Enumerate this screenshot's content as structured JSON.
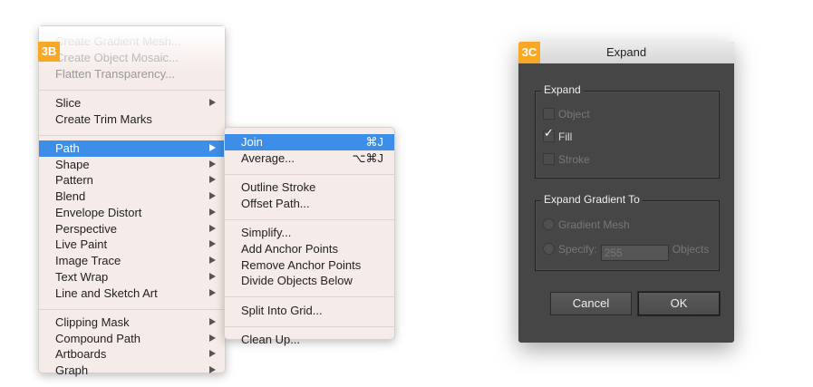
{
  "menu_badge": "3B",
  "main_menu": [
    {
      "label": "Create Gradient Mesh...",
      "state": "disabled"
    },
    {
      "label": "Create Object Mosaic...",
      "state": "disabled"
    },
    {
      "label": "Flatten Transparency...",
      "state": "disabled"
    },
    {
      "sep": true
    },
    {
      "label": "Slice",
      "submenu": true
    },
    {
      "label": "Create Trim Marks"
    },
    {
      "sep": true
    },
    {
      "label": "Path",
      "submenu": true,
      "state": "highlighted"
    },
    {
      "label": "Shape",
      "submenu": true
    },
    {
      "label": "Pattern",
      "submenu": true
    },
    {
      "label": "Blend",
      "submenu": true
    },
    {
      "label": "Envelope Distort",
      "submenu": true
    },
    {
      "label": "Perspective",
      "submenu": true
    },
    {
      "label": "Live Paint",
      "submenu": true
    },
    {
      "label": "Image Trace",
      "submenu": true
    },
    {
      "label": "Text Wrap",
      "submenu": true
    },
    {
      "label": "Line and Sketch Art",
      "submenu": true
    },
    {
      "sep": true
    },
    {
      "label": "Clipping Mask",
      "submenu": true
    },
    {
      "label": "Compound Path",
      "submenu": true
    },
    {
      "label": "Artboards",
      "submenu": true
    },
    {
      "label": "Graph",
      "submenu": true
    }
  ],
  "path_submenu": [
    {
      "label": "Join",
      "shortcut": "⌘J",
      "state": "highlighted"
    },
    {
      "label": "Average...",
      "shortcut": "⌥⌘J"
    },
    {
      "sep": true
    },
    {
      "label": "Outline Stroke"
    },
    {
      "label": "Offset Path..."
    },
    {
      "sep": true
    },
    {
      "label": "Simplify..."
    },
    {
      "label": "Add Anchor Points"
    },
    {
      "label": "Remove Anchor Points"
    },
    {
      "label": "Divide Objects Below"
    },
    {
      "sep": true
    },
    {
      "label": "Split Into Grid..."
    },
    {
      "sep": true
    },
    {
      "label": "Clean Up..."
    }
  ],
  "dialog": {
    "badge": "3C",
    "title": "Expand",
    "expand_group": {
      "title": "Expand",
      "object": "Object",
      "fill": "Fill",
      "stroke": "Stroke",
      "fill_checked": true
    },
    "gradient_group": {
      "title": "Expand Gradient To",
      "gradient_mesh": "Gradient Mesh",
      "specify": "Specify:",
      "specify_value": "255",
      "objects": "Objects"
    },
    "cancel": "Cancel",
    "ok": "OK"
  }
}
